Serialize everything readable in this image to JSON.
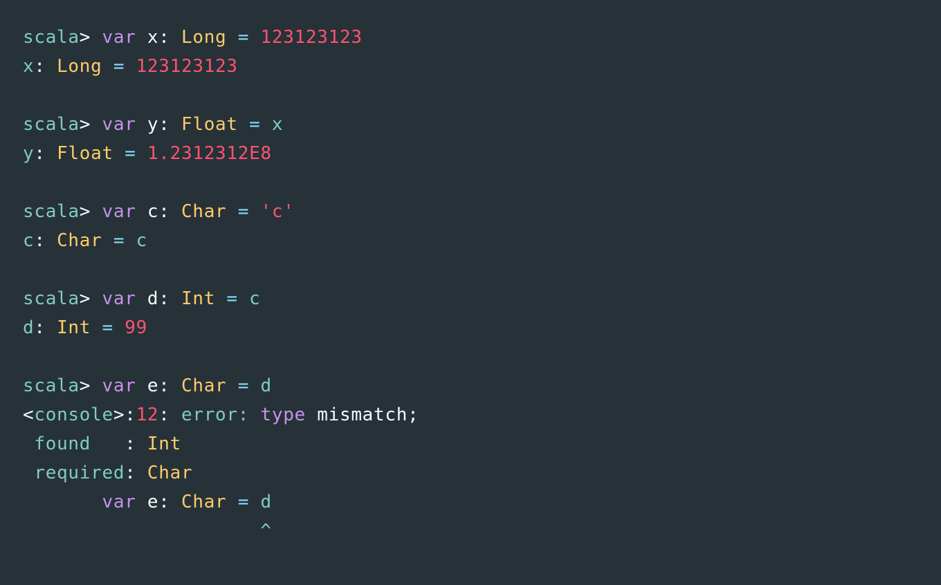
{
  "terminal": {
    "app": "Scala REPL",
    "background_color": "#263238",
    "colors": {
      "prompt": "#80CBC4",
      "keyword": "#C792EA",
      "type": "#FFCB6B",
      "number": "#FF5370",
      "string": "#FF5370",
      "identifier": "#EEFFFF",
      "operator": "#89DDFF",
      "message": "#80CBC4",
      "punctuation": "#EEFFFF"
    },
    "lines": [
      {
        "id": "line-1-input-x",
        "kind": "input",
        "text": "scala> var x: Long = 123123123",
        "tokens": [
          {
            "t": "scala",
            "c": "prompt"
          },
          {
            "t": ">",
            "c": "punct"
          },
          {
            "t": " ",
            "c": "plain"
          },
          {
            "t": "var",
            "c": "keyword"
          },
          {
            "t": " ",
            "c": "plain"
          },
          {
            "t": "x",
            "c": "ident"
          },
          {
            "t": ":",
            "c": "punct"
          },
          {
            "t": " ",
            "c": "plain"
          },
          {
            "t": "Long",
            "c": "type"
          },
          {
            "t": " ",
            "c": "plain"
          },
          {
            "t": "=",
            "c": "operator"
          },
          {
            "t": " ",
            "c": "plain"
          },
          {
            "t": "123123123",
            "c": "number"
          }
        ]
      },
      {
        "id": "line-2-output-x",
        "kind": "output",
        "text": "x: Long = 123123123",
        "tokens": [
          {
            "t": "x",
            "c": "var"
          },
          {
            "t": ":",
            "c": "punct"
          },
          {
            "t": " ",
            "c": "plain"
          },
          {
            "t": "Long",
            "c": "type"
          },
          {
            "t": " ",
            "c": "plain"
          },
          {
            "t": "=",
            "c": "operator"
          },
          {
            "t": " ",
            "c": "plain"
          },
          {
            "t": "123123123",
            "c": "number"
          }
        ]
      },
      {
        "id": "line-3-blank",
        "kind": "blank",
        "text": "",
        "tokens": []
      },
      {
        "id": "line-4-input-y",
        "kind": "input",
        "text": "scala> var y: Float = x",
        "tokens": [
          {
            "t": "scala",
            "c": "prompt"
          },
          {
            "t": ">",
            "c": "punct"
          },
          {
            "t": " ",
            "c": "plain"
          },
          {
            "t": "var",
            "c": "keyword"
          },
          {
            "t": " ",
            "c": "plain"
          },
          {
            "t": "y",
            "c": "ident"
          },
          {
            "t": ":",
            "c": "punct"
          },
          {
            "t": " ",
            "c": "plain"
          },
          {
            "t": "Float",
            "c": "type"
          },
          {
            "t": " ",
            "c": "plain"
          },
          {
            "t": "=",
            "c": "operator"
          },
          {
            "t": " ",
            "c": "plain"
          },
          {
            "t": "x",
            "c": "var"
          }
        ]
      },
      {
        "id": "line-5-output-y",
        "kind": "output",
        "text": "y: Float = 1.2312312E8",
        "tokens": [
          {
            "t": "y",
            "c": "var"
          },
          {
            "t": ":",
            "c": "punct"
          },
          {
            "t": " ",
            "c": "plain"
          },
          {
            "t": "Float",
            "c": "type"
          },
          {
            "t": " ",
            "c": "plain"
          },
          {
            "t": "=",
            "c": "operator"
          },
          {
            "t": " ",
            "c": "plain"
          },
          {
            "t": "1.2312312E8",
            "c": "number"
          }
        ]
      },
      {
        "id": "line-6-blank",
        "kind": "blank",
        "text": "",
        "tokens": []
      },
      {
        "id": "line-7-input-c",
        "kind": "input",
        "text": "scala> var c: Char = 'c'",
        "tokens": [
          {
            "t": "scala",
            "c": "prompt"
          },
          {
            "t": ">",
            "c": "punct"
          },
          {
            "t": " ",
            "c": "plain"
          },
          {
            "t": "var",
            "c": "keyword"
          },
          {
            "t": " ",
            "c": "plain"
          },
          {
            "t": "c",
            "c": "ident"
          },
          {
            "t": ":",
            "c": "punct"
          },
          {
            "t": " ",
            "c": "plain"
          },
          {
            "t": "Char",
            "c": "type"
          },
          {
            "t": " ",
            "c": "plain"
          },
          {
            "t": "=",
            "c": "operator"
          },
          {
            "t": " ",
            "c": "plain"
          },
          {
            "t": "'c'",
            "c": "string"
          }
        ]
      },
      {
        "id": "line-8-output-c",
        "kind": "output",
        "text": "c: Char = c",
        "tokens": [
          {
            "t": "c",
            "c": "var"
          },
          {
            "t": ":",
            "c": "punct"
          },
          {
            "t": " ",
            "c": "plain"
          },
          {
            "t": "Char",
            "c": "type"
          },
          {
            "t": " ",
            "c": "plain"
          },
          {
            "t": "=",
            "c": "operator"
          },
          {
            "t": " ",
            "c": "plain"
          },
          {
            "t": "c",
            "c": "var"
          }
        ]
      },
      {
        "id": "line-9-blank",
        "kind": "blank",
        "text": "",
        "tokens": []
      },
      {
        "id": "line-10-input-d",
        "kind": "input",
        "text": "scala> var d: Int = c",
        "tokens": [
          {
            "t": "scala",
            "c": "prompt"
          },
          {
            "t": ">",
            "c": "punct"
          },
          {
            "t": " ",
            "c": "plain"
          },
          {
            "t": "var",
            "c": "keyword"
          },
          {
            "t": " ",
            "c": "plain"
          },
          {
            "t": "d",
            "c": "ident"
          },
          {
            "t": ":",
            "c": "punct"
          },
          {
            "t": " ",
            "c": "plain"
          },
          {
            "t": "Int",
            "c": "type"
          },
          {
            "t": " ",
            "c": "plain"
          },
          {
            "t": "=",
            "c": "operator"
          },
          {
            "t": " ",
            "c": "plain"
          },
          {
            "t": "c",
            "c": "var"
          }
        ]
      },
      {
        "id": "line-11-output-d",
        "kind": "output",
        "text": "d: Int = 99",
        "tokens": [
          {
            "t": "d",
            "c": "var"
          },
          {
            "t": ":",
            "c": "punct"
          },
          {
            "t": " ",
            "c": "plain"
          },
          {
            "t": "Int",
            "c": "type"
          },
          {
            "t": " ",
            "c": "plain"
          },
          {
            "t": "=",
            "c": "operator"
          },
          {
            "t": " ",
            "c": "plain"
          },
          {
            "t": "99",
            "c": "number"
          }
        ]
      },
      {
        "id": "line-12-blank",
        "kind": "blank",
        "text": "",
        "tokens": []
      },
      {
        "id": "line-13-input-e",
        "kind": "input",
        "text": "scala> var e: Char = d",
        "tokens": [
          {
            "t": "scala",
            "c": "prompt"
          },
          {
            "t": ">",
            "c": "punct"
          },
          {
            "t": " ",
            "c": "plain"
          },
          {
            "t": "var",
            "c": "keyword"
          },
          {
            "t": " ",
            "c": "plain"
          },
          {
            "t": "e",
            "c": "ident"
          },
          {
            "t": ":",
            "c": "punct"
          },
          {
            "t": " ",
            "c": "plain"
          },
          {
            "t": "Char",
            "c": "type"
          },
          {
            "t": " ",
            "c": "plain"
          },
          {
            "t": "=",
            "c": "operator"
          },
          {
            "t": " ",
            "c": "plain"
          },
          {
            "t": "d",
            "c": "var"
          }
        ]
      },
      {
        "id": "line-14-error-header",
        "kind": "error",
        "text": "<console>:12: error: type mismatch;",
        "tokens": [
          {
            "t": "<",
            "c": "punct"
          },
          {
            "t": "console",
            "c": "msg"
          },
          {
            "t": ">",
            "c": "punct"
          },
          {
            "t": ":",
            "c": "punct"
          },
          {
            "t": "12",
            "c": "number"
          },
          {
            "t": ":",
            "c": "punct"
          },
          {
            "t": " ",
            "c": "plain"
          },
          {
            "t": "error:",
            "c": "msg"
          },
          {
            "t": " ",
            "c": "plain"
          },
          {
            "t": "type",
            "c": "keyword"
          },
          {
            "t": " ",
            "c": "plain"
          },
          {
            "t": "mismatch;",
            "c": "plain"
          }
        ]
      },
      {
        "id": "line-15-error-found",
        "kind": "error",
        "text": " found   : Int",
        "tokens": [
          {
            "t": " ",
            "c": "plain"
          },
          {
            "t": "found",
            "c": "msg"
          },
          {
            "t": "   ",
            "c": "plain"
          },
          {
            "t": ":",
            "c": "punct"
          },
          {
            "t": " ",
            "c": "plain"
          },
          {
            "t": "Int",
            "c": "type"
          }
        ]
      },
      {
        "id": "line-16-error-required",
        "kind": "error",
        "text": " required: Char",
        "tokens": [
          {
            "t": " ",
            "c": "plain"
          },
          {
            "t": "required",
            "c": "msg"
          },
          {
            "t": ":",
            "c": "punct"
          },
          {
            "t": " ",
            "c": "plain"
          },
          {
            "t": "Char",
            "c": "type"
          }
        ]
      },
      {
        "id": "line-17-error-source",
        "kind": "error",
        "text": "       var e: Char = d",
        "tokens": [
          {
            "t": "       ",
            "c": "plain"
          },
          {
            "t": "var",
            "c": "keyword"
          },
          {
            "t": " ",
            "c": "plain"
          },
          {
            "t": "e",
            "c": "ident"
          },
          {
            "t": ":",
            "c": "punct"
          },
          {
            "t": " ",
            "c": "plain"
          },
          {
            "t": "Char",
            "c": "type"
          },
          {
            "t": " ",
            "c": "plain"
          },
          {
            "t": "=",
            "c": "operator"
          },
          {
            "t": " ",
            "c": "plain"
          },
          {
            "t": "d",
            "c": "var"
          }
        ]
      },
      {
        "id": "line-18-error-caret",
        "kind": "error",
        "text": "                     ^",
        "tokens": [
          {
            "t": "                     ",
            "c": "plain"
          },
          {
            "t": "^",
            "c": "caret"
          }
        ]
      }
    ]
  }
}
